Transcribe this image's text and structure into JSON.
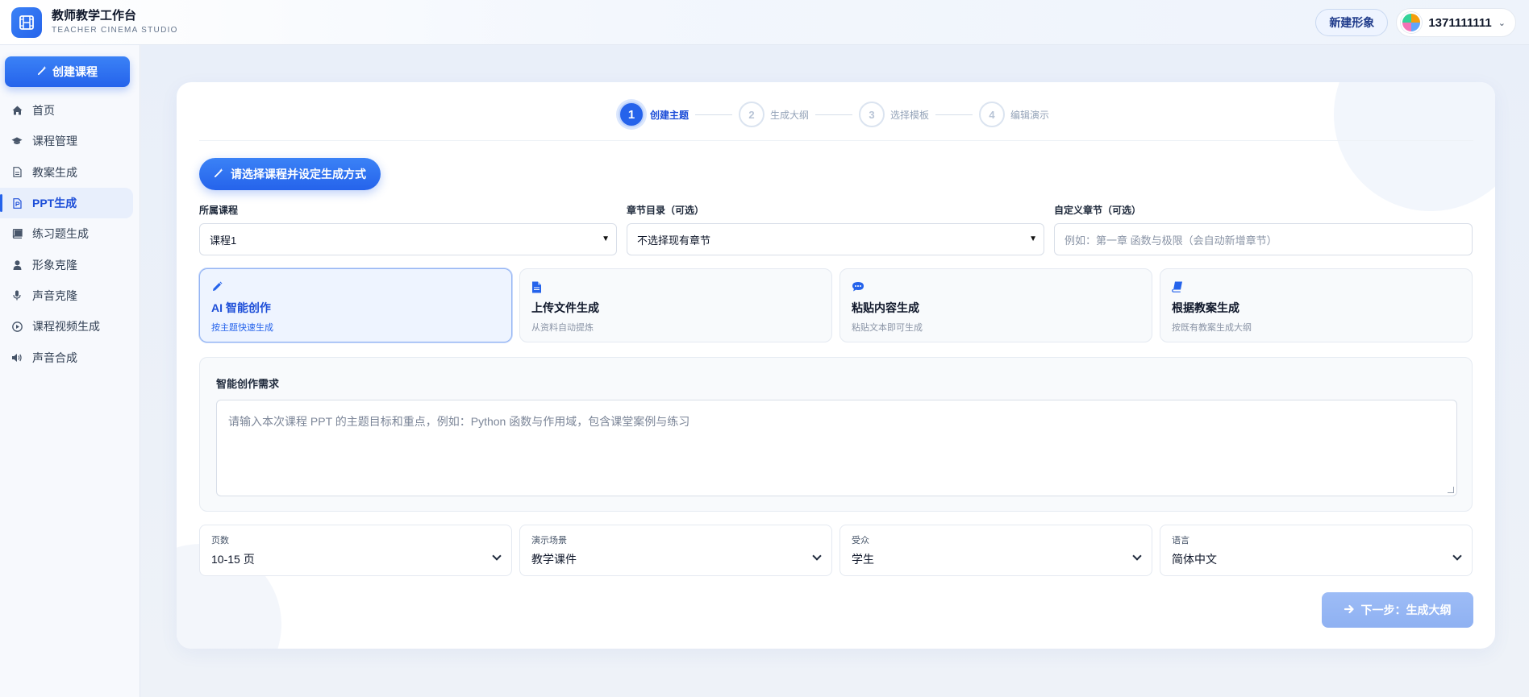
{
  "app": {
    "title": "教师教学工作台",
    "subtitle": "TEACHER CINEMA STUDIO",
    "accent_color": "#2563eb"
  },
  "header": {
    "new_avatar_label": "新建形象",
    "user_name": "1371111111"
  },
  "sidebar": {
    "create_course_label": "创建课程",
    "items": [
      {
        "label": "首页",
        "icon": "home-icon",
        "active": false
      },
      {
        "label": "课程管理",
        "icon": "graduation-cap-icon",
        "active": false
      },
      {
        "label": "教案生成",
        "icon": "document-icon",
        "active": false
      },
      {
        "label": "PPT生成",
        "icon": "presentation-file-icon",
        "active": true
      },
      {
        "label": "练习题生成",
        "icon": "book-icon",
        "active": false
      },
      {
        "label": "形象克隆",
        "icon": "user-icon",
        "active": false
      },
      {
        "label": "声音克隆",
        "icon": "microphone-icon",
        "active": false
      },
      {
        "label": "课程视频生成",
        "icon": "play-circle-icon",
        "active": false
      },
      {
        "label": "声音合成",
        "icon": "speaker-icon",
        "active": false
      }
    ]
  },
  "steps": [
    {
      "num": "1",
      "label": "创建主题",
      "active": true
    },
    {
      "num": "2",
      "label": "生成大纲",
      "active": false
    },
    {
      "num": "3",
      "label": "选择模板",
      "active": false
    },
    {
      "num": "4",
      "label": "编辑演示",
      "active": false
    }
  ],
  "form": {
    "section_title": "请选择课程并设定生成方式",
    "course": {
      "label": "所属课程",
      "value": "课程1"
    },
    "chapter": {
      "label": "章节目录（可选）",
      "value": "不选择现有章节"
    },
    "custom_chapter": {
      "label": "自定义章节（可选）",
      "placeholder": "例如：第一章 函数与极限（会自动新增章节）"
    }
  },
  "modes": [
    {
      "title": "AI 智能创作",
      "sub": "按主题快速生成",
      "icon": "pencil-icon",
      "active": true
    },
    {
      "title": "上传文件生成",
      "sub": "从资料自动提炼",
      "icon": "file-icon",
      "active": false
    },
    {
      "title": "粘贴内容生成",
      "sub": "粘贴文本即可生成",
      "icon": "chat-bubble-icon",
      "active": false
    },
    {
      "title": "根据教案生成",
      "sub": "按既有教案生成大纲",
      "icon": "book-icon",
      "active": false
    }
  ],
  "requirement": {
    "label": "智能创作需求",
    "placeholder": "请输入本次课程 PPT 的主题目标和重点，例如：Python 函数与作用域，包含课堂案例与练习"
  },
  "options": [
    {
      "label": "页数",
      "value": "10-15 页"
    },
    {
      "label": "演示场景",
      "value": "教学课件"
    },
    {
      "label": "受众",
      "value": "学生"
    },
    {
      "label": "语言",
      "value": "简体中文"
    }
  ],
  "next_button_label": "下一步：生成大纲"
}
